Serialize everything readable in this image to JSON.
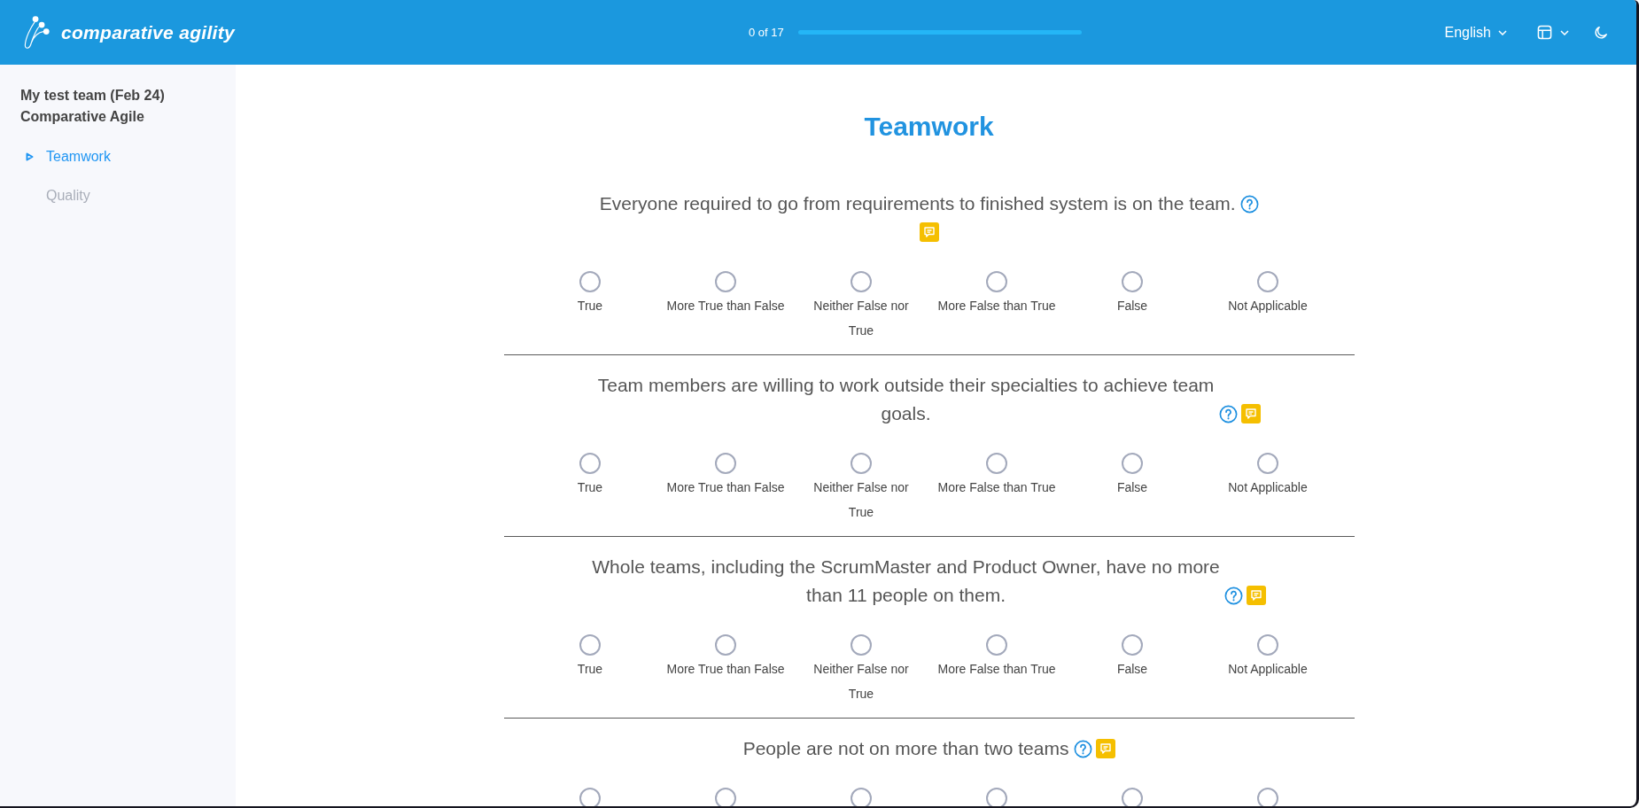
{
  "header": {
    "app_name": "comparative agility",
    "progress": {
      "text": "0 of 17",
      "level": 0
    },
    "language": "English"
  },
  "sidebar": {
    "team": "My test team (Feb 24)",
    "survey": "Comparative Agile",
    "items": [
      {
        "label": "Teamwork",
        "selected": true
      },
      {
        "label": "Quality",
        "selected": false
      }
    ]
  },
  "page": {
    "title": "Teamwork",
    "questions": [
      {
        "text": "Everyone required to go from requirements to finished system is on the team.",
        "help": true,
        "comment": true,
        "options": [
          {
            "label": "True",
            "selected": false
          },
          {
            "label": "More True than False",
            "selected": false
          },
          {
            "label": "Neither False nor True",
            "selected": false
          },
          {
            "label": "More False than True",
            "selected": false
          },
          {
            "label": "False",
            "selected": false
          },
          {
            "label": "Not Applicable",
            "selected": false
          }
        ]
      },
      {
        "text": "Team members are willing to work outside their specialties to achieve team goals.",
        "help": true,
        "comment": true,
        "options": [
          {
            "label": "True",
            "selected": false
          },
          {
            "label": "More True than False",
            "selected": false
          },
          {
            "label": "Neither False nor True",
            "selected": false
          },
          {
            "label": "More False than True",
            "selected": false
          },
          {
            "label": "False",
            "selected": false
          },
          {
            "label": "Not Applicable",
            "selected": false
          }
        ]
      },
      {
        "text": "Whole teams, including the ScrumMaster and Product Owner, have no more than 11 people on them.",
        "help": true,
        "comment": true,
        "options": [
          {
            "label": "True",
            "selected": false
          },
          {
            "label": "More True than False",
            "selected": false
          },
          {
            "label": "Neither False nor True",
            "selected": false
          },
          {
            "label": "More False than True",
            "selected": false
          },
          {
            "label": "False",
            "selected": false
          },
          {
            "label": "Not Applicable",
            "selected": false
          }
        ]
      },
      {
        "text": "People are not on more than two teams",
        "help": true,
        "comment": true,
        "options": [
          {
            "selected": false
          },
          {
            "selected": false
          },
          {
            "selected": false
          },
          {
            "selected": false
          },
          {
            "selected": false
          },
          {
            "selected": false
          }
        ]
      }
    ]
  }
}
